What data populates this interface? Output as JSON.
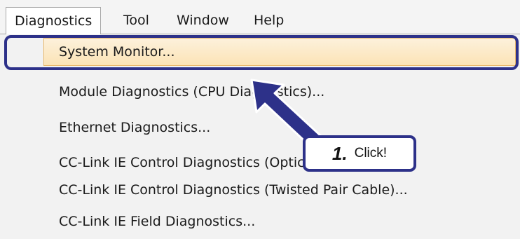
{
  "menubar": {
    "items": [
      {
        "label": "Diagnostics"
      },
      {
        "label": "Tool"
      },
      {
        "label": "Window"
      },
      {
        "label": "Help"
      }
    ]
  },
  "dropdown": {
    "items": [
      {
        "label": "System Monitor..."
      },
      {
        "label": "Module Diagnostics (CPU Diagnostics)..."
      },
      {
        "label": "Ethernet Diagnostics..."
      },
      {
        "label": "CC-Link IE Control Diagnostics (Optical Cable)..."
      },
      {
        "label": "CC-Link IE Control Diagnostics (Twisted Pair Cable)..."
      },
      {
        "label": "CC-Link IE Field Diagnostics..."
      }
    ]
  },
  "callout": {
    "step": "1.",
    "text": "Click!"
  },
  "colors": {
    "accent": "#2d3189",
    "highlight": "#fbe3b6"
  }
}
